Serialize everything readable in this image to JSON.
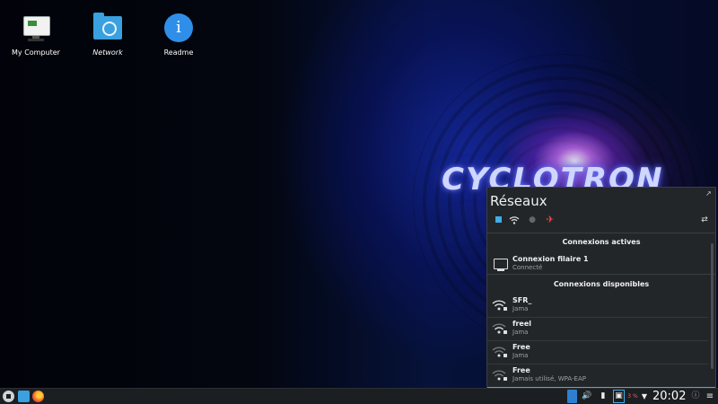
{
  "desktop": {
    "icons": [
      {
        "label": "My Computer"
      },
      {
        "label": "Network"
      },
      {
        "label": "Readme"
      }
    ],
    "wallpaper_text": "CYCLOTRON"
  },
  "network_panel": {
    "title": "Réseaux",
    "active_header": "Connexions actives",
    "available_header": "Connexions disponibles",
    "active": [
      {
        "name": "Connexion filaire 1",
        "status": "Connecté"
      }
    ],
    "available": [
      {
        "name": "SFR_",
        "status": "Jama"
      },
      {
        "name": "freel",
        "status": "Jama"
      },
      {
        "name": "Free",
        "status": "Jama"
      },
      {
        "name": "Free",
        "status": "Jamais utilisé, WPA-EAP"
      }
    ],
    "accent": "#3daee9"
  },
  "taskbar": {
    "clock": "20:02",
    "battery_text": "3 %"
  }
}
